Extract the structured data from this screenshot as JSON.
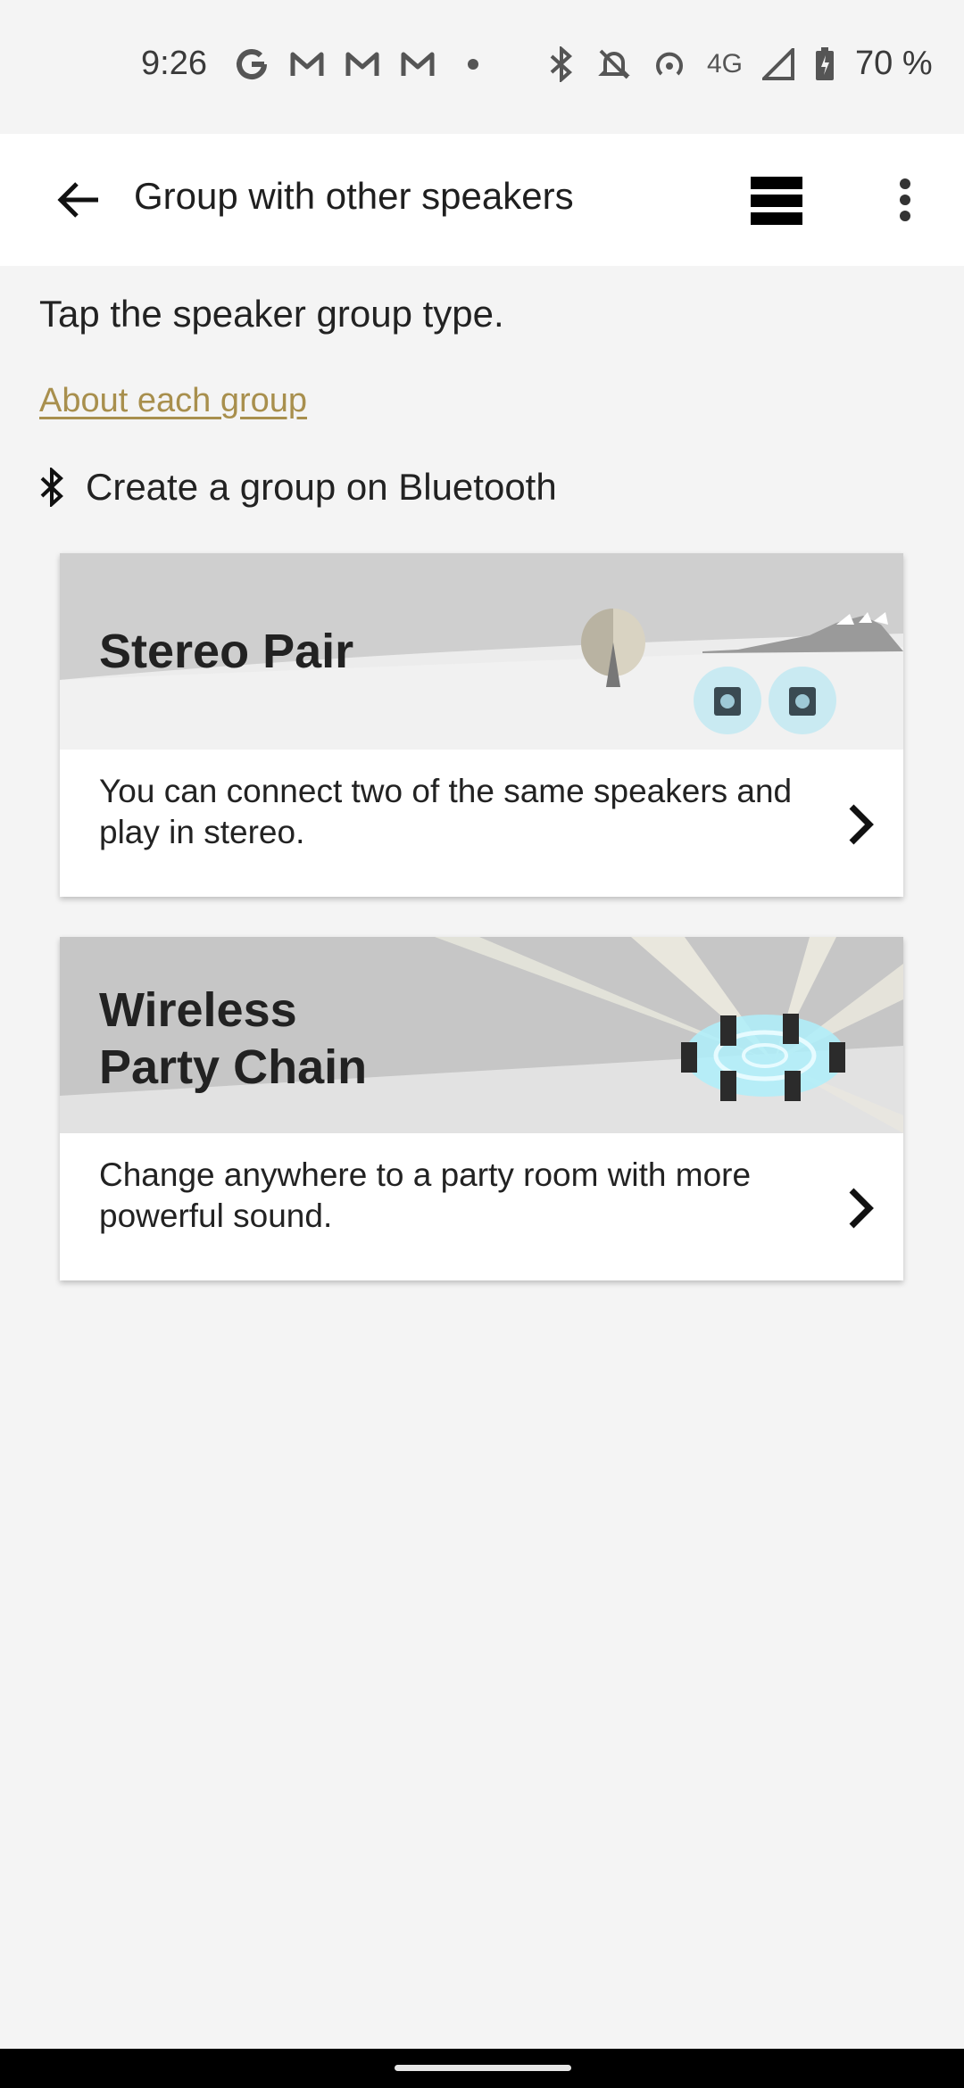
{
  "status_bar": {
    "time": "9:26",
    "battery": "70 %",
    "network": "4G",
    "left_icons": [
      "google-icon",
      "gmail-icon",
      "gmail-icon",
      "gmail-icon",
      "dot-icon"
    ],
    "right_icons": [
      "bluetooth-icon",
      "mute-icon",
      "hotspot-icon",
      "signal-icon",
      "battery-icon"
    ]
  },
  "app_bar": {
    "title": "Group with other speakers",
    "back_icon": "arrow-back-icon",
    "view_icon": "list-view-icon",
    "menu_icon": "more-vert-icon"
  },
  "content": {
    "instruction": "Tap the speaker group type.",
    "about_link": "About each group",
    "bluetooth_section": "Create a group on Bluetooth"
  },
  "cards": [
    {
      "title": "Stereo Pair",
      "description": "You can connect two of the same speakers and play in stereo."
    },
    {
      "title_line1": "Wireless",
      "title_line2": "Party Chain",
      "description": "Change anywhere to a party room with more powerful sound."
    }
  ],
  "colors": {
    "link": "#a88f4d",
    "background": "#f4f4f4",
    "card": "#ffffff"
  }
}
